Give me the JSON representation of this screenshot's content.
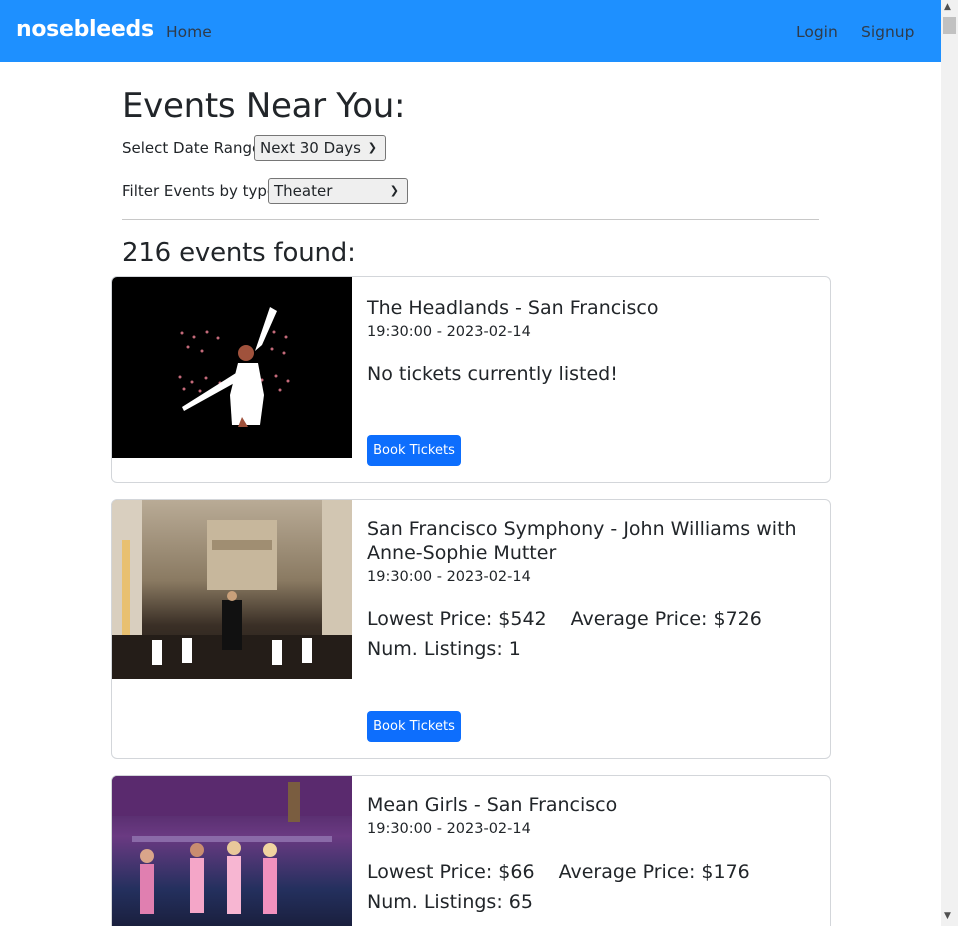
{
  "nav": {
    "brand": "nosebleeds",
    "home": "Home",
    "login": "Login",
    "signup": "Signup"
  },
  "page": {
    "title": "Events Near You:",
    "date_label": "Select Date Range:",
    "date_value": "Next 30 Days",
    "type_label": "Filter Events by type:",
    "type_value": "Theater",
    "count": "216 events found:"
  },
  "events": [
    {
      "title": "The Headlands - San Francisco",
      "time": "19:30:00 - 2023-02-14",
      "message": "No tickets currently listed!",
      "button": "Book Tickets",
      "image": "dancer-illustration"
    },
    {
      "title": "San Francisco Symphony - John Williams with Anne-Sophie Mutter",
      "time": "19:30:00 - 2023-02-14",
      "lowest": "Lowest Price: $542",
      "average": "Average Price: $726",
      "listings": "Num. Listings: 1",
      "button": "Book Tickets",
      "image": "orchestra-photo"
    },
    {
      "title": "Mean Girls - San Francisco",
      "time": "19:30:00 - 2023-02-14",
      "lowest": "Lowest Price: $66",
      "average": "Average Price: $176",
      "listings": "Num. Listings: 65",
      "image": "stage-cast-photo"
    }
  ],
  "icons": {
    "chevron": "chevron-down-icon",
    "scroll_up": "scroll-up-arrow-icon",
    "scroll_down": "scroll-down-arrow-icon"
  },
  "colors": {
    "navbar": "#1e90ff",
    "button": "#0d6efd",
    "text": "#212529"
  }
}
